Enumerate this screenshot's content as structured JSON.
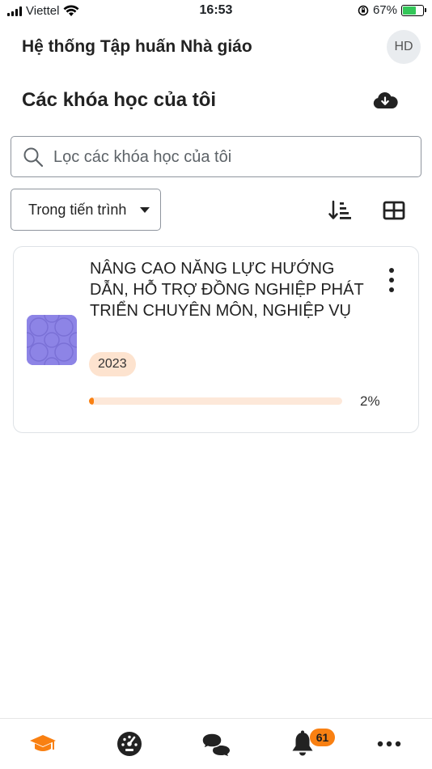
{
  "status_bar": {
    "carrier": "Viettel",
    "time": "16:53",
    "battery": "67%"
  },
  "header": {
    "app_title": "Hệ thống Tập huấn Nhà giáo",
    "avatar_initials": "HD"
  },
  "page": {
    "title": "Các khóa học của tôi"
  },
  "search": {
    "placeholder": "Lọc các khóa học của tôi",
    "value": ""
  },
  "filter": {
    "selected": "Trong tiến trình"
  },
  "courses": [
    {
      "name": "NÂNG CAO NĂNG LỰC HƯỚNG DẪN, HỖ TRỢ ĐỒNG NGHIỆP PHÁT TRIỂN CHUYÊN MÔN, NGHIỆP VỤ",
      "badge": "2023",
      "progress_percent": 2,
      "progress_label": "2%"
    }
  ],
  "tab_bar": {
    "tabs": [
      "my-courses",
      "dashboard",
      "messages",
      "notifications",
      "more"
    ],
    "notifications_count": "61"
  },
  "colors": {
    "accent": "#f98012",
    "progress_track": "#fde8d9",
    "badge_bg": "#fde3cf",
    "course_image": "#8d84e6"
  }
}
